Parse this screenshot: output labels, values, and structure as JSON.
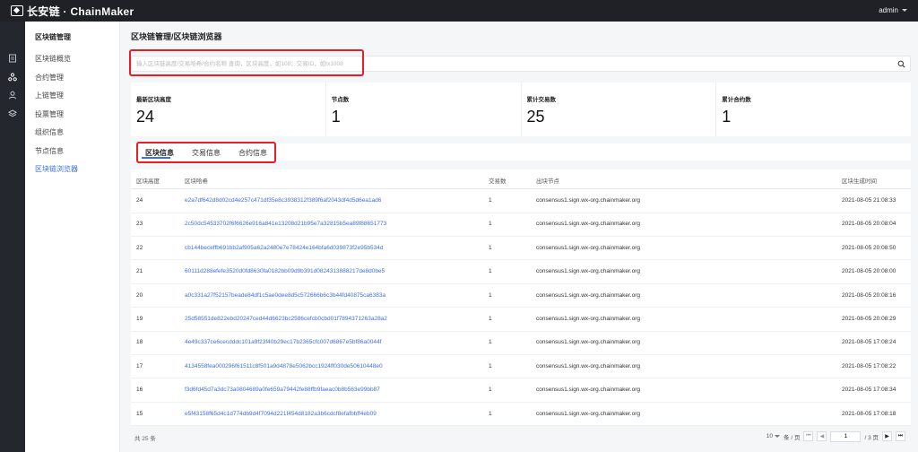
{
  "header": {
    "logo_text": "长安链 · ChainMaker",
    "user": "admin"
  },
  "rail": {
    "icons": [
      "document-icon",
      "blockchain-icon",
      "user-icon",
      "layers-icon"
    ]
  },
  "sidebar": {
    "title": "区块链管理",
    "items": [
      {
        "label": "区块链概览"
      },
      {
        "label": "合约管理"
      },
      {
        "label": "上链管理"
      },
      {
        "label": "投票管理"
      },
      {
        "label": "组织信息"
      },
      {
        "label": "节点信息"
      },
      {
        "label": "区块链浏览器"
      }
    ]
  },
  "breadcrumb": "区块链管理/区块链浏览器",
  "search": {
    "value": "",
    "placeholder": "输入区块链高度/交易哈希/合约名称 查询，区块高度，如108；交易ID，如tx1008"
  },
  "stats": [
    {
      "label": "最新区块高度",
      "value": "24"
    },
    {
      "label": "节点数",
      "value": "1"
    },
    {
      "label": "累计交易数",
      "value": "25"
    },
    {
      "label": "累计合约数",
      "value": "1"
    }
  ],
  "tabs": [
    {
      "label": "区块信息"
    },
    {
      "label": "交易信息"
    },
    {
      "label": "合约信息"
    }
  ],
  "active_tab": "区块信息",
  "table": {
    "columns": [
      "区块高度",
      "区块哈希",
      "交易数",
      "出块节点",
      "区块生成时间"
    ],
    "rows": [
      {
        "height": "24",
        "hash": "e2a7df642d8d02cd4e257c471df35e8c3938312f389f6af2043df4d5d6ea1ad6",
        "tx": "1",
        "node": "consensus1.sign.wx-org.chainmaker.org",
        "time": "2021-08-05 21:08:33"
      },
      {
        "height": "23",
        "hash": "2c50dc54533702f6f6626e916a841e13208d21b95e7a32815b5ea89f88651773",
        "tx": "1",
        "node": "consensus1.sign.wx-org.chainmaker.org",
        "time": "2021-08-05 20:08:04"
      },
      {
        "height": "22",
        "hash": "cb144beceffb691bb2af905a62a2480e7e78424e164bfa6d039873f2e95b534d",
        "tx": "1",
        "node": "consensus1.sign.wx-org.chainmaker.org",
        "time": "2021-08-05 20:08:50"
      },
      {
        "height": "21",
        "hash": "60111d288efefe3520d0fd8630fa0182bb09d9b391d0824313888217de8d0be5",
        "tx": "1",
        "node": "consensus1.sign.wx-org.chainmaker.org",
        "time": "2021-08-05 20:08:00"
      },
      {
        "height": "20",
        "hash": "a0c331a27f52157beade84df1c5ae0dee8d5c572666b6c3b44fd40875ca6383a",
        "tx": "1",
        "node": "consensus1.sign.wx-org.chainmaker.org",
        "time": "2021-08-05 20:08:16"
      },
      {
        "height": "19",
        "hash": "25d58551de822ebd20247ced44d6623bc2586cefcb0cbd01f7894371263a28a2",
        "tx": "1",
        "node": "consensus1.sign.wx-org.chainmaker.org",
        "time": "2021-08-05 20:08:29"
      },
      {
        "height": "18",
        "hash": "4e49c337ce6cecdddc101a9f23f40b29ec17b2365cfc007d6867e5bf86a0044f",
        "tx": "1",
        "node": "consensus1.sign.wx-org.chainmaker.org",
        "time": "2021-08-05 17:08:24"
      },
      {
        "height": "17",
        "hash": "4134558fea000296f61511c8f501a9d4878e5062bcc1924ff030de50610448e0",
        "tx": "1",
        "node": "consensus1.sign.wx-org.chainmaker.org",
        "time": "2021-08-05 17:08:22"
      },
      {
        "height": "16",
        "hash": "f3d6fd45d7a3dc73a0804689a0fe659a79442fe88ffb9faeac0b8b563e99bb87",
        "tx": "1",
        "node": "consensus1.sign.wx-org.chainmaker.org",
        "time": "2021-08-05 17:08:34"
      },
      {
        "height": "15",
        "hash": "e5f43158f65d4c1d774db9d4f7094d221f454d8182a3b6cdcf8efafbbff4eb09",
        "tx": "1",
        "node": "consensus1.sign.wx-org.chainmaker.org",
        "time": "2021-08-05 17:08:18"
      }
    ]
  },
  "pagination": {
    "total_text": "共 25 条",
    "page_size": "10",
    "page_size_suffix": "条 / 页",
    "current_page": "1",
    "page_total_text": "/ 3 页"
  },
  "colors": {
    "accent": "#3d6fe8",
    "highlight_box": "#e81e25",
    "topbar": "#1f2126"
  }
}
